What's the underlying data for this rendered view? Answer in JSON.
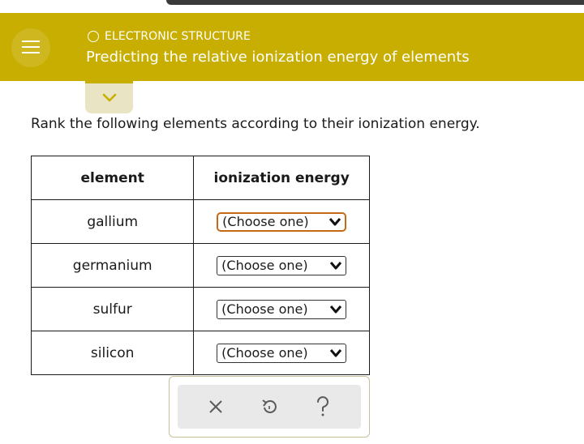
{
  "header": {
    "topic": "ELECTRONIC STRUCTURE",
    "title": "Predicting the relative ionization energy of elements"
  },
  "question": {
    "instruction": "Rank the following elements according to their ionization energy."
  },
  "table": {
    "headers": [
      "element",
      "ionization energy"
    ],
    "rows": [
      {
        "element": "gallium",
        "selection": "(Choose one)"
      },
      {
        "element": "germanium",
        "selection": "(Choose one)"
      },
      {
        "element": "sulfur",
        "selection": "(Choose one)"
      },
      {
        "element": "silicon",
        "selection": "(Choose one)"
      }
    ]
  },
  "colors": {
    "header_bg": "#c8ae00",
    "focus_ring": "#c46a17",
    "toolbar_bg": "#e9e9e9"
  },
  "icons": {
    "menu": "hamburger-icon",
    "topic": "circle-icon",
    "expand": "chevron-down-icon",
    "select": "chevron-down-icon",
    "toolbar": [
      "close-icon",
      "undo-icon",
      "help-icon"
    ]
  }
}
